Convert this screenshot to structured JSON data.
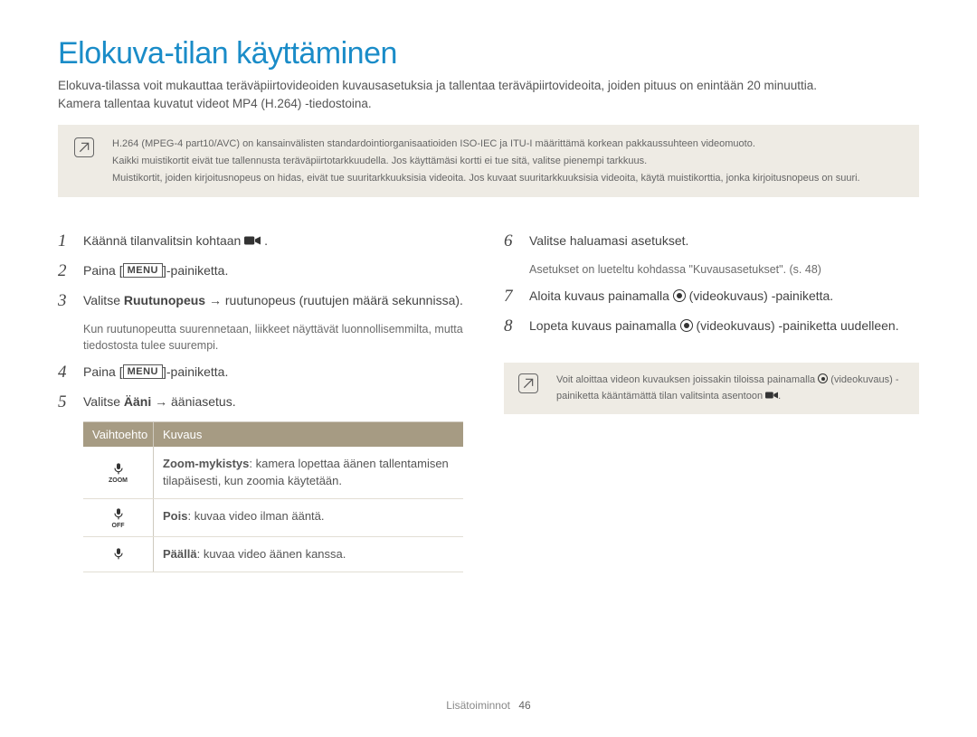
{
  "title": "Elokuva-tilan käyttäminen",
  "intro1": "Elokuva-tilassa voit mukauttaa teräväpiirtovideoiden kuvausasetuksia ja tallentaa teräväpiirtovideoita, joiden pituus on enintään 20 minuuttia.",
  "intro2": "Kamera tallentaa kuvatut videot MP4 (H.264) -tiedostoina.",
  "topnote": {
    "lines": [
      "H.264 (MPEG-4 part10/AVC) on kansainvälisten standardointiorganisaatioiden ISO-IEC ja ITU-I määrittämä korkean pakkaussuhteen videomuoto.",
      "Kaikki muistikortit eivät tue tallennusta teräväpiirtotarkkuudella. Jos käyttämäsi kortti ei tue sitä, valitse pienempi tarkkuus.",
      "Muistikortit, joiden kirjoitusnopeus on hidas, eivät tue suuritarkkuuksisia videoita. Jos kuvaat suuritarkkuuksisia videoita, käytä muistikorttia, jonka kirjoitusnopeus on suuri."
    ]
  },
  "left": {
    "s1": {
      "num": "1",
      "text_a": "Käännä tilanvalitsin kohtaan ",
      "text_b": "."
    },
    "s2": {
      "num": "2",
      "text_a": "Paina [",
      "text_b": "]-painiketta."
    },
    "s3": {
      "num": "3",
      "text_a": "Valitse ",
      "bold1": "Ruutunopeus",
      "arrow": " → ",
      "text_b": "ruutunopeus (ruutujen määrä sekunnissa).",
      "sub": "Kun ruutunopeutta suurennetaan, liikkeet näyttävät luonnollisemmilta, mutta tiedostosta tulee suurempi."
    },
    "s4": {
      "num": "4",
      "text_a": "Paina [",
      "text_b": "]-painiketta."
    },
    "s5": {
      "num": "5",
      "text_a": "Valitse ",
      "bold1": "Ääni",
      "arrow": " → ",
      "text_b": "ääniasetus."
    }
  },
  "table": {
    "head": {
      "c1": "Vaihtoehto",
      "c2": "Kuvaus"
    },
    "rows": [
      {
        "icon": "zoom-mute",
        "b": "Zoom-mykistys",
        "t": ": kamera lopettaa äänen tallentamisen tilapäisesti, kun zoomia käytetään."
      },
      {
        "icon": "mic-off",
        "b": "Pois",
        "t": ": kuvaa video ilman ääntä."
      },
      {
        "icon": "mic",
        "b": "Päällä",
        "t": ": kuvaa video äänen kanssa."
      }
    ]
  },
  "right": {
    "s6": {
      "num": "6",
      "text": "Valitse haluamasi asetukset.",
      "sub": "Asetukset on lueteltu kohdassa \"Kuvausasetukset\". (s. 48)"
    },
    "s7": {
      "num": "7",
      "a": "Aloita kuvaus painamalla ",
      "b": " (videokuvaus) -painiketta."
    },
    "s8": {
      "num": "8",
      "a": "Lopeta kuvaus painamalla ",
      "b": " (videokuvaus) -painiketta uudelleen."
    },
    "note": {
      "a": "Voit aloittaa videon kuvauksen joissakin tiloissa painamalla ",
      "b": " (videokuvaus) -painiketta kääntämättä tilan valitsinta asentoon ",
      "c": "."
    }
  },
  "footer": {
    "section": "Lisätoiminnot",
    "page": "46"
  },
  "icons": {
    "menu_label": "MENU",
    "movie": "movie-mode-icon"
  }
}
